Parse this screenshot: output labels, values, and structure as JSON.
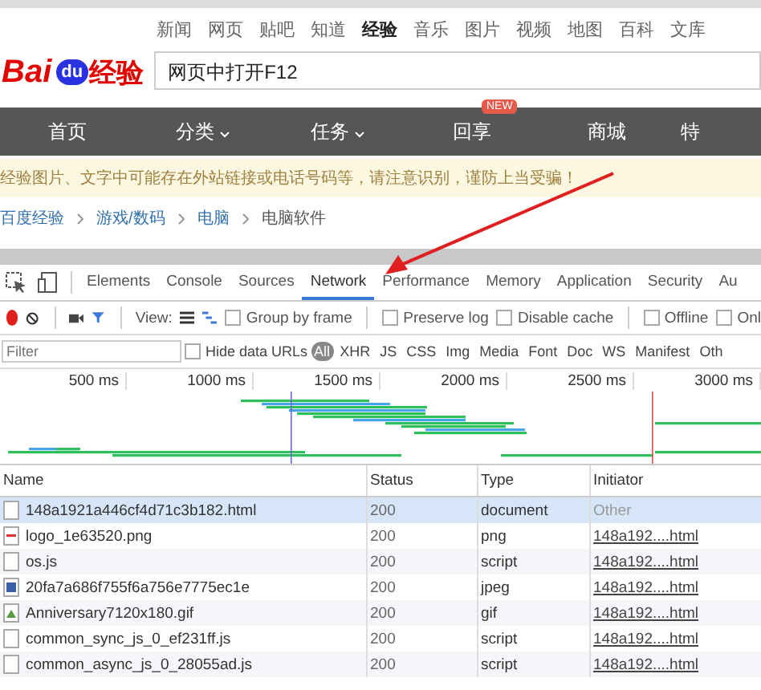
{
  "site": {
    "logo_latin": "Bai",
    "logo_du": "du",
    "logo_cn": "经验",
    "top_links": [
      {
        "label": "新闻",
        "selected": false
      },
      {
        "label": "网页",
        "selected": false
      },
      {
        "label": "贴吧",
        "selected": false
      },
      {
        "label": "知道",
        "selected": false
      },
      {
        "label": "经验",
        "selected": true
      },
      {
        "label": "音乐",
        "selected": false
      },
      {
        "label": "图片",
        "selected": false
      },
      {
        "label": "视频",
        "selected": false
      },
      {
        "label": "地图",
        "selected": false
      },
      {
        "label": "百科",
        "selected": false
      },
      {
        "label": "文库",
        "selected": false
      }
    ],
    "search": {
      "value": "网页中打开F12"
    },
    "nav": [
      {
        "label": "首页",
        "caret": false
      },
      {
        "label": "分类",
        "caret": true
      },
      {
        "label": "任务",
        "caret": true
      },
      {
        "label": "回享",
        "caret": false,
        "badge": "NEW"
      },
      {
        "label": "商城",
        "caret": false
      },
      {
        "label": "特",
        "caret": false
      }
    ],
    "notice": "经验图片、文字中可能存在外站链接或电话号码等，请注意识别，谨防上当受骗！",
    "breadcrumb": [
      "百度经验",
      "游戏/数码",
      "电脑",
      "电脑软件"
    ]
  },
  "devtools": {
    "tabs": [
      {
        "label": "Elements",
        "selected": false
      },
      {
        "label": "Console",
        "selected": false
      },
      {
        "label": "Sources",
        "selected": false
      },
      {
        "label": "Network",
        "selected": true
      },
      {
        "label": "Performance",
        "selected": false
      },
      {
        "label": "Memory",
        "selected": false
      },
      {
        "label": "Application",
        "selected": false
      },
      {
        "label": "Security",
        "selected": false
      },
      {
        "label": "Au",
        "selected": false
      }
    ],
    "recording": true,
    "view_label": "View:",
    "options": [
      {
        "label": "Group by frame",
        "checked": false
      },
      {
        "label": "Preserve log",
        "checked": false
      },
      {
        "label": "Disable cache",
        "checked": false
      },
      {
        "label": "Offline",
        "checked": false
      },
      {
        "label": "Onl",
        "checked": false
      }
    ],
    "filter": {
      "placeholder": "Filter"
    },
    "hide_data_urls": {
      "label": "Hide data URLs",
      "checked": false
    },
    "types": [
      {
        "label": "All",
        "selected": true
      },
      {
        "label": "XHR",
        "selected": false
      },
      {
        "label": "JS",
        "selected": false
      },
      {
        "label": "CSS",
        "selected": false
      },
      {
        "label": "Img",
        "selected": false
      },
      {
        "label": "Media",
        "selected": false
      },
      {
        "label": "Font",
        "selected": false
      },
      {
        "label": "Doc",
        "selected": false
      },
      {
        "label": "WS",
        "selected": false
      },
      {
        "label": "Manifest",
        "selected": false
      },
      {
        "label": "Oth",
        "selected": false
      }
    ],
    "timeline_ticks": [
      "500 ms",
      "1000 ms",
      "1500 ms",
      "2000 ms",
      "2500 ms",
      "3000 ms"
    ],
    "table": {
      "columns": [
        "Name",
        "Status",
        "Type",
        "Initiator"
      ],
      "rows": [
        {
          "kind": "document",
          "name": "148a1921a446cf4d71c3b182.html",
          "status": "200",
          "type": "document",
          "initiator": "Other",
          "link": false,
          "selected": true
        },
        {
          "kind": "image",
          "name": "logo_1e63520.png",
          "status": "200",
          "type": "png",
          "initiator": "148a192....html",
          "link": true,
          "selected": false
        },
        {
          "kind": "document",
          "name": "os.js",
          "status": "200",
          "type": "script",
          "initiator": "148a192....html",
          "link": true,
          "selected": false
        },
        {
          "kind": "photo",
          "name": "20fa7a686f755f6a756e7775ec1e",
          "status": "200",
          "type": "jpeg",
          "initiator": "148a192....html",
          "link": true,
          "selected": false
        },
        {
          "kind": "gif",
          "name": "Anniversary7120x180.gif",
          "status": "200",
          "type": "gif",
          "initiator": "148a192....html",
          "link": true,
          "selected": false
        },
        {
          "kind": "document",
          "name": "common_sync_js_0_ef231ff.js",
          "status": "200",
          "type": "script",
          "initiator": "148a192....html",
          "link": true,
          "selected": false
        },
        {
          "kind": "document",
          "name": "common_async_js_0_28055ad.js",
          "status": "200",
          "type": "script",
          "initiator": "148a192....html",
          "link": true,
          "selected": false
        }
      ]
    }
  }
}
